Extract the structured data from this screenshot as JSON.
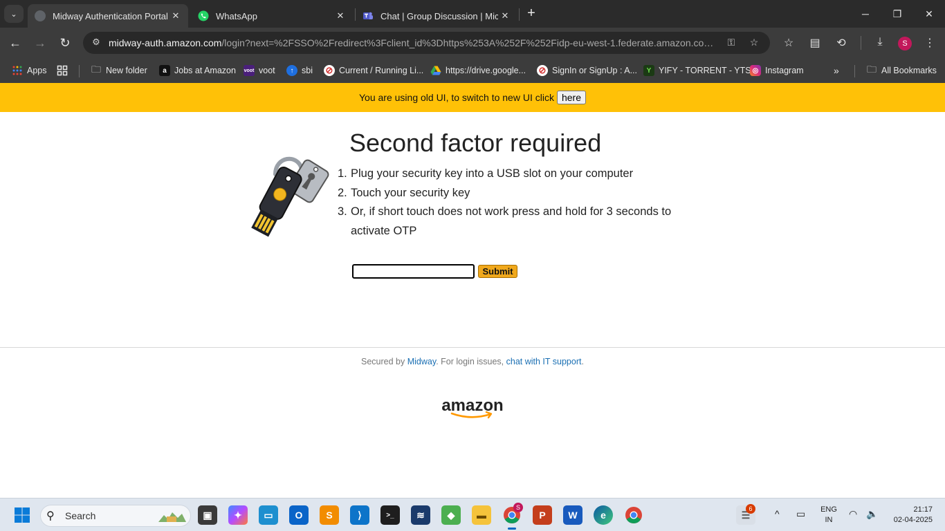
{
  "tabs": [
    {
      "title": "Midway Authentication Portal",
      "active": true
    },
    {
      "title": "WhatsApp",
      "active": false
    },
    {
      "title": "Chat | Group Discussion | Microsoft Teams",
      "active": false
    }
  ],
  "address": {
    "host": "midway-auth.amazon.com",
    "path": "/login?next=%2FSSO%2Fredirect%3Fclient_id%3Dhttps%253A%252F%252Fidp-eu-west-1.federate.amazon.com%..."
  },
  "bookmarks": [
    {
      "label": "Apps",
      "icon": "apps-grid-icon"
    },
    {
      "label": "",
      "icon": "tab-groups-icon"
    },
    {
      "label": "New folder",
      "icon": "folder-icon"
    },
    {
      "label": "Jobs at Amazon",
      "icon": "amazon-icon"
    },
    {
      "label": "voot",
      "icon": "voot-icon"
    },
    {
      "label": "sbi",
      "icon": "sbi-icon"
    },
    {
      "label": "Current / Running Li...",
      "icon": "blocked-icon"
    },
    {
      "label": "https://drive.google...",
      "icon": "google-drive-icon"
    },
    {
      "label": "SignIn or SignUp : A...",
      "icon": "blocked-icon"
    },
    {
      "label": "YIFY - TORRENT - YTS",
      "icon": "yify-icon"
    },
    {
      "label": "Instagram",
      "icon": "instagram-icon"
    }
  ],
  "bookmarks_overflow": "»",
  "all_bookmarks": "All Bookmarks",
  "banner": {
    "text": "You are using old UI, to switch to new UI click",
    "button": "here"
  },
  "page": {
    "heading": "Second factor required",
    "steps": [
      {
        "num": "1.",
        "text": "Plug your security key into a USB slot on your computer"
      },
      {
        "num": "2.",
        "text": "Touch your security key"
      },
      {
        "num": "3.",
        "text": "Or, if short touch does not work press and hold for 3 seconds to activate OTP"
      }
    ],
    "otp_value": "",
    "submit_label": "Submit"
  },
  "footer": {
    "prefix": "Secured by ",
    "midway_link": "Midway",
    "middle": ". For login issues, ",
    "support_link": "chat with IT support",
    "suffix": "."
  },
  "taskbar": {
    "search_label": "Search",
    "notification_count": "6",
    "chrome_profile_badge": "S",
    "lang_line1": "ENG",
    "lang_line2": "IN",
    "time": "21:17",
    "date": "02-04-2025"
  },
  "profile_initial": "S",
  "colors": {
    "banner": "#ffc107",
    "submit": "#f0a81c",
    "link": "#1a6fb3",
    "amazon_smile": "#ff9900"
  }
}
